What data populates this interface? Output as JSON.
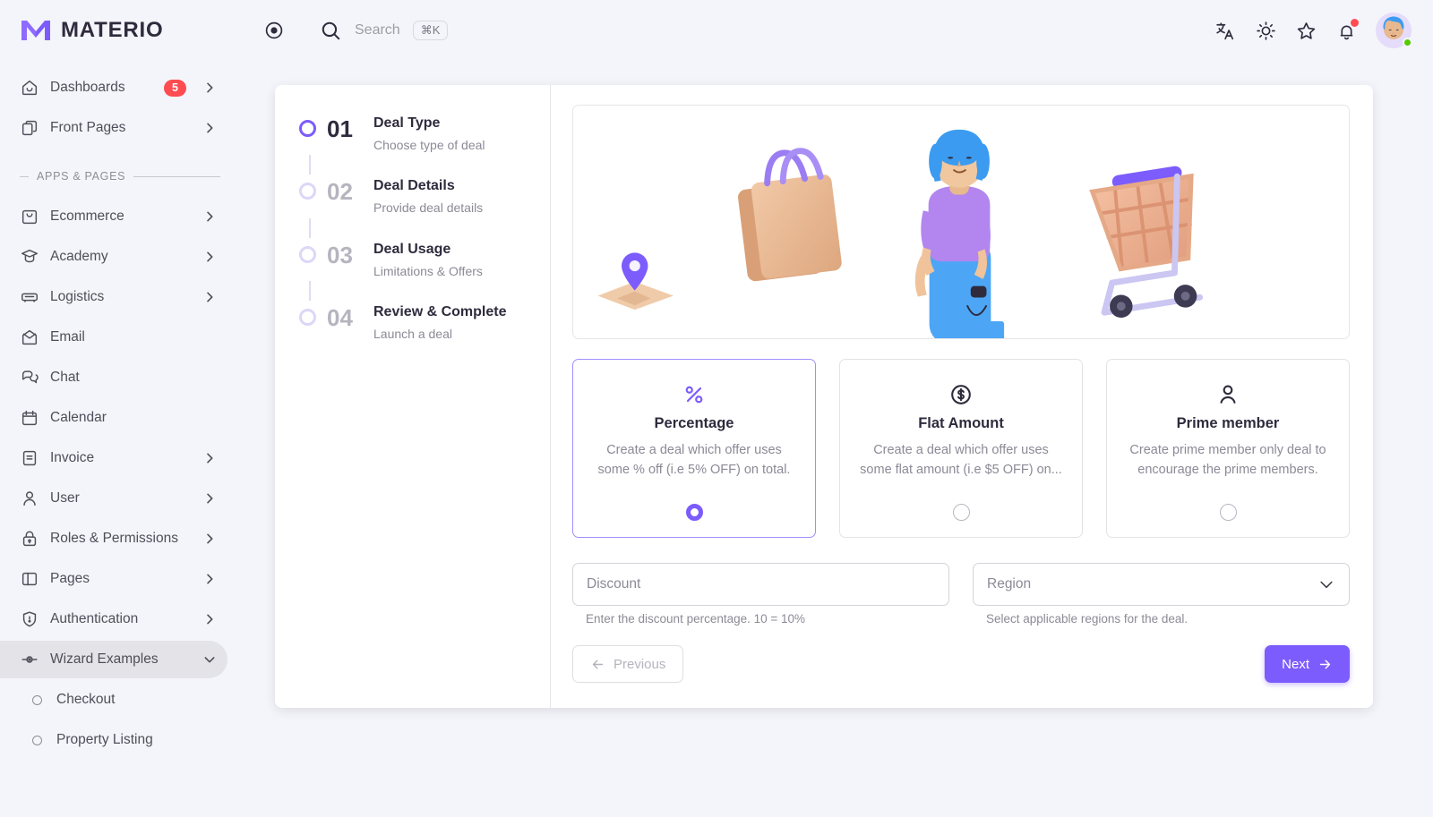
{
  "brand": {
    "name": "MATERIO",
    "logo_icon": "materio-logo-icon"
  },
  "topbar": {
    "record_icon": "record-circle-icon",
    "search": {
      "icon": "search-icon",
      "placeholder": "Search",
      "shortcut": "⌘K"
    },
    "actions": [
      {
        "name": "translate-icon",
        "label": "Translate"
      },
      {
        "name": "sun-icon",
        "label": "Theme"
      },
      {
        "name": "star-icon",
        "label": "Shortcuts"
      },
      {
        "name": "bell-icon",
        "label": "Notifications"
      }
    ],
    "avatar": {
      "name": "avatar",
      "status": "online"
    }
  },
  "sidebar": {
    "section_label": "APPS & PAGES",
    "top_items": [
      {
        "label": "Dashboards",
        "icon": "home-icon",
        "badge": "5",
        "chevron": "chevron-right-icon"
      },
      {
        "label": "Front Pages",
        "icon": "copy-icon",
        "badge": "",
        "chevron": "chevron-right-icon"
      }
    ],
    "items": [
      {
        "label": "Ecommerce",
        "icon": "shopping-bag-icon",
        "chevron": "chevron-right-icon"
      },
      {
        "label": "Academy",
        "icon": "graduation-cap-icon",
        "chevron": "chevron-right-icon"
      },
      {
        "label": "Logistics",
        "icon": "truck-icon",
        "chevron": "chevron-right-icon"
      },
      {
        "label": "Email",
        "icon": "envelope-icon",
        "chevron": ""
      },
      {
        "label": "Chat",
        "icon": "chat-bubble-icon",
        "chevron": ""
      },
      {
        "label": "Calendar",
        "icon": "calendar-icon",
        "chevron": ""
      },
      {
        "label": "Invoice",
        "icon": "document-icon",
        "chevron": "chevron-right-icon"
      },
      {
        "label": "User",
        "icon": "user-icon",
        "chevron": "chevron-right-icon"
      },
      {
        "label": "Roles & Permissions",
        "icon": "lock-icon",
        "chevron": "chevron-right-icon"
      },
      {
        "label": "Pages",
        "icon": "layout-icon",
        "chevron": "chevron-right-icon"
      },
      {
        "label": "Authentication",
        "icon": "shield-icon",
        "chevron": "chevron-right-icon"
      },
      {
        "label": "Wizard Examples",
        "icon": "slider-icon",
        "chevron": "chevron-down-icon",
        "active": true
      }
    ],
    "sub_items": [
      {
        "label": "Checkout"
      },
      {
        "label": "Property Listing"
      }
    ]
  },
  "stepper": {
    "steps": [
      {
        "num": "01",
        "title": "Deal Type",
        "subtitle": "Choose type of deal",
        "active": true
      },
      {
        "num": "02",
        "title": "Deal Details",
        "subtitle": "Provide deal details",
        "active": false
      },
      {
        "num": "03",
        "title": "Deal Usage",
        "subtitle": "Limitations & Offers",
        "active": false
      },
      {
        "num": "04",
        "title": "Review & Complete",
        "subtitle": "Launch a deal",
        "active": false
      }
    ]
  },
  "hero": {
    "illustration": "shopping-woman-cart-illustration",
    "elements": [
      "map-pin",
      "shopping-bags",
      "woman-character",
      "shopping-cart"
    ]
  },
  "deal_types": [
    {
      "title": "Percentage",
      "description": "Create a deal which offer uses some % off (i.e 5% OFF) on total.",
      "icon": "percent-icon",
      "selected": true
    },
    {
      "title": "Flat Amount",
      "description": "Create a deal which offer uses some flat amount (i.e $5 OFF) on...",
      "icon": "dollar-circle-icon",
      "selected": false
    },
    {
      "title": "Prime member",
      "description": "Create prime member only deal to encourage the prime members.",
      "icon": "user-icon",
      "selected": false
    }
  ],
  "form": {
    "discount": {
      "placeholder": "Discount",
      "value": "",
      "helper": "Enter the discount percentage. 10 = 10%"
    },
    "region": {
      "placeholder": "Region",
      "value": "",
      "helper": "Select applicable regions for the deal.",
      "chevron": "chevron-down-icon"
    }
  },
  "buttons": {
    "previous": {
      "label": "Previous",
      "icon": "arrow-left-icon",
      "disabled": true
    },
    "next": {
      "label": "Next",
      "icon": "arrow-right-icon"
    }
  },
  "colors": {
    "accent": "#7C5CFC",
    "badge": "#FF4C51",
    "online": "#56CA00",
    "page_bg": "#F4F5FA",
    "text": "#2F2B3D",
    "muted": "#8C8A96"
  }
}
